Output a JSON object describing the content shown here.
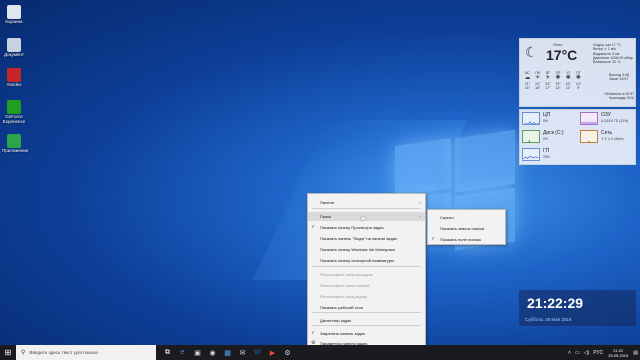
{
  "desktop": {
    "icons": [
      {
        "label": "Корзина",
        "icon": "recycle-bin-icon",
        "color": "#dfe6ee"
      },
      {
        "label": "Документ",
        "icon": "document-icon",
        "color": "#c7d3e0"
      },
      {
        "label": "Yandex",
        "icon": "browser-icon",
        "color": "#c6262b"
      },
      {
        "label": "GeForce Experience",
        "icon": "nvidia-icon",
        "color": "#1f9e1f"
      },
      {
        "label": "Приложение",
        "icon": "app-icon",
        "color": "#2ba44a"
      }
    ]
  },
  "weather": {
    "city": "Ясно",
    "temp": "17°C",
    "details": [
      "Ощущ. как 17 °C",
      "Ветер ⇙ 1 м/с",
      "Видимость 9 км",
      "Давление 1006,09 мбар",
      "Влажность 32 %"
    ],
    "days": [
      {
        "d": "ВС",
        "hi": "21°",
        "lo": "16°"
      },
      {
        "d": "ПН",
        "hi": "24°",
        "lo": "16°"
      },
      {
        "d": "ВТ",
        "hi": "24°",
        "lo": "17°"
      },
      {
        "d": "СР",
        "hi": "19°",
        "lo": "13°"
      },
      {
        "d": "ЧТ",
        "hi": "16°",
        "lo": "11°"
      },
      {
        "d": "ПТ",
        "hi": "14°",
        "lo": "9°"
      }
    ],
    "sunrise": "Восход 4:48",
    "sunset": "Закат 19:57",
    "updated": "Обновлено в 20:57",
    "location": "Краснодар KDA"
  },
  "perf": {
    "cpu": {
      "name": "ЦП",
      "val": "5%"
    },
    "ram": {
      "name": "ОЗУ",
      "val": "5,2/15,8 ГБ (33%)"
    },
    "disk": {
      "name": "Диск (C:)",
      "val": "0%"
    },
    "net": {
      "name": "Сеть",
      "val": "⇑ 0 ⇓ 0 кбит/с"
    },
    "gpu": {
      "name": "ГП",
      "val": "28%"
    }
  },
  "clock_widget": {
    "time": "21:22:29",
    "date": "Суббота, 25 Мая 2019"
  },
  "context_menu": {
    "items": [
      {
        "label": "Панели",
        "submenu": true
      },
      {
        "label": "Поиск",
        "submenu": true,
        "highlighted": true
      },
      {
        "label": "Показать кнопку Просмотра задач",
        "checked": true
      },
      {
        "label": "Показать панель \"Люди\" на панели задач"
      },
      {
        "label": "Показать кнопку Windows Ink Workspace"
      },
      {
        "label": "Показать кнопку сенсорной клавиатуры"
      },
      {
        "label": "Расположить окна каскадом",
        "disabled": true
      },
      {
        "label": "Расположить окна стопкой",
        "disabled": true
      },
      {
        "label": "Расположить окна рядом",
        "disabled": true
      },
      {
        "label": "Показать рабочий стол"
      },
      {
        "label": "Диспетчер задач"
      },
      {
        "label": "Закрепить панель задач",
        "checked": true
      },
      {
        "label": "Параметры панели задач",
        "gear": true
      }
    ]
  },
  "search_submenu": {
    "items": [
      {
        "label": "Скрыто"
      },
      {
        "label": "Показать значок поиска"
      },
      {
        "label": "Показать поле поиска",
        "checked": true
      }
    ]
  },
  "taskbar": {
    "search_placeholder": "Введите здесь текст для поиска",
    "apps": [
      {
        "icon": "task-view-icon",
        "glyph": "⧉",
        "color": "#ffffff"
      },
      {
        "icon": "edge-icon",
        "glyph": "e",
        "color": "#3c8be8"
      },
      {
        "icon": "store-icon",
        "glyph": "▣",
        "color": "#cfd8e8"
      },
      {
        "icon": "steam-icon",
        "glyph": "◉",
        "color": "#cfd8e8"
      },
      {
        "icon": "photos-icon",
        "glyph": "▦",
        "color": "#4da3ff"
      },
      {
        "icon": "mail-icon",
        "glyph": "✉",
        "color": "#cfd8e8"
      },
      {
        "icon": "word-icon",
        "glyph": "W",
        "color": "#2b5fb8"
      },
      {
        "icon": "media-icon",
        "glyph": "▶",
        "color": "#e84c3d"
      },
      {
        "icon": "settings-icon",
        "glyph": "⚙",
        "color": "#cfd8e8"
      }
    ],
    "tray_lang": "РУС",
    "tray_time": "21:22",
    "tray_date": "25.05.2019"
  }
}
